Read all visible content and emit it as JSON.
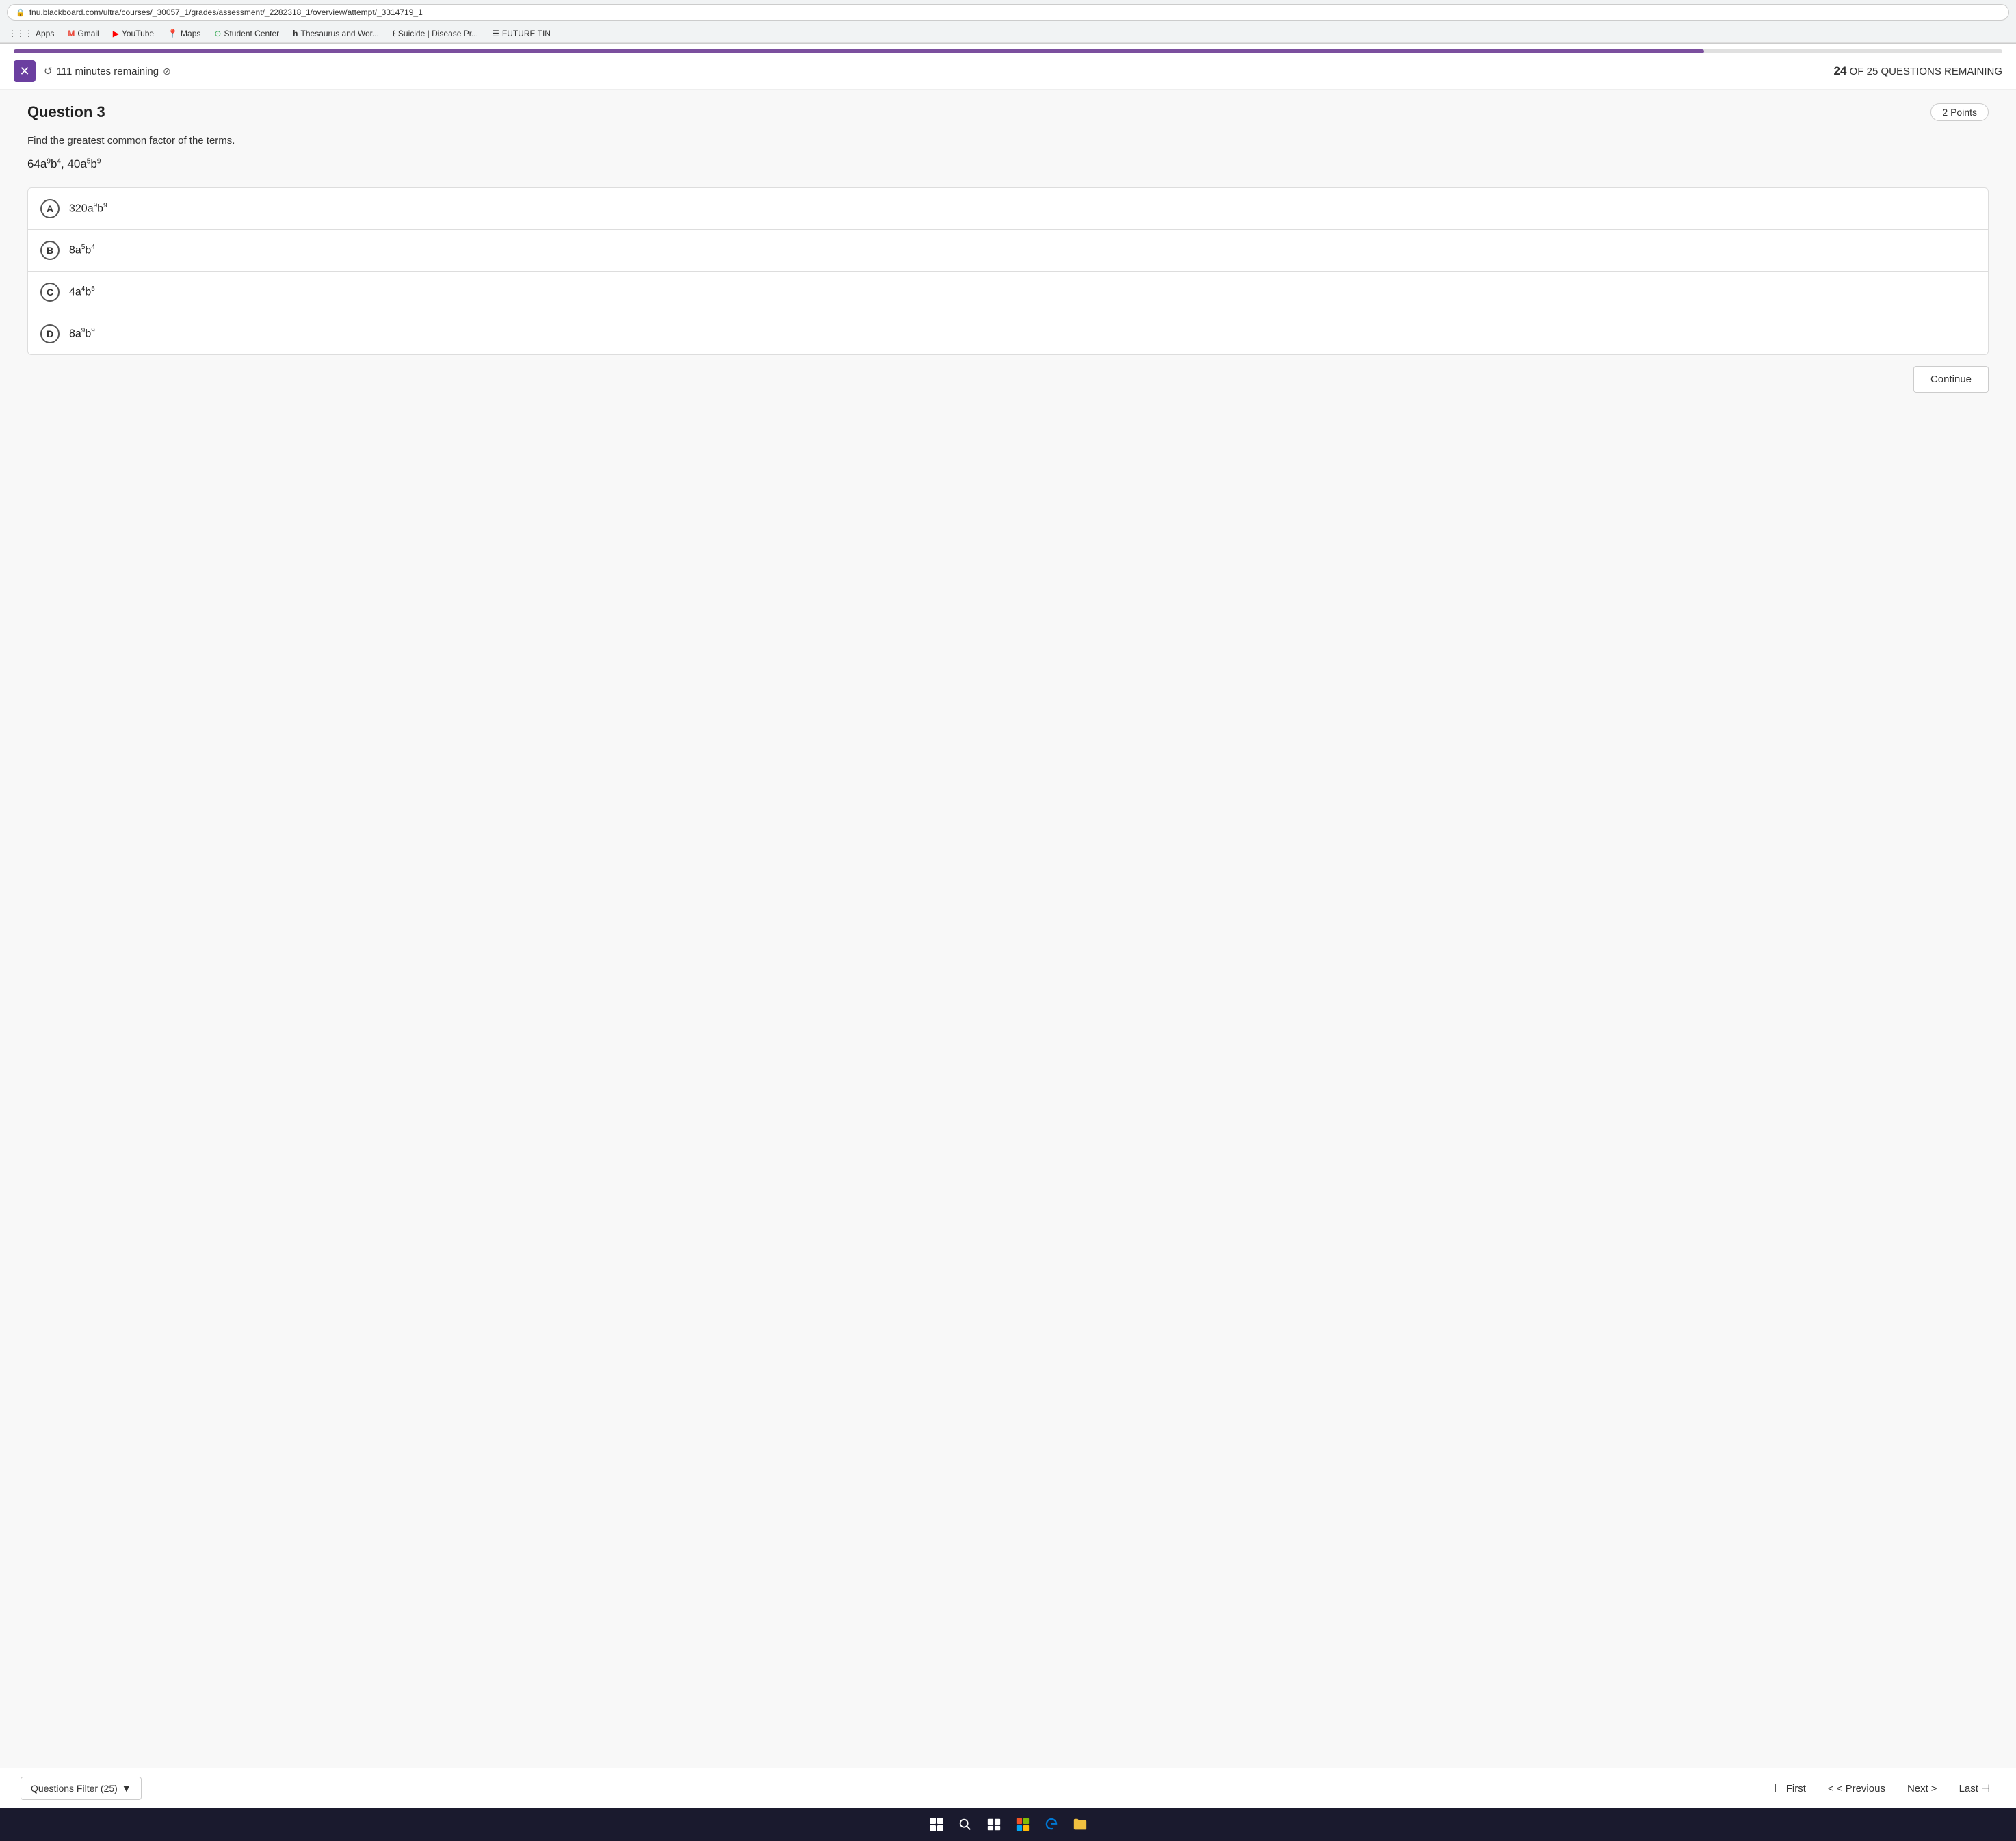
{
  "browser": {
    "url": "fnu.blackboard.com/ultra/courses/_30057_1/grades/assessment/_2282318_1/overview/attempt/_3314719_1",
    "lock_icon": "🔒"
  },
  "bookmarks": [
    {
      "id": "apps",
      "icon": "⋮⋮⋮",
      "label": "Apps"
    },
    {
      "id": "gmail",
      "icon": "M",
      "label": "Gmail"
    },
    {
      "id": "youtube",
      "icon": "▶",
      "label": "YouTube"
    },
    {
      "id": "maps",
      "icon": "📍",
      "label": "Maps"
    },
    {
      "id": "student-center",
      "icon": "⊙",
      "label": "Student Center"
    },
    {
      "id": "thesaurus",
      "icon": "h",
      "label": "Thesaurus and Wor..."
    },
    {
      "id": "suicide",
      "icon": "ℓ",
      "label": "Suicide | Disease Pr..."
    },
    {
      "id": "future-tin",
      "icon": "☰",
      "label": "FUTURE TIN"
    }
  ],
  "quiz": {
    "timer": {
      "text": "111 minutes remaining",
      "icon": "↺",
      "no_calc_icon": "⊘",
      "progress_pct": 85
    },
    "questions_remaining": {
      "current": "24",
      "total": "25",
      "label": "OF 25 QUESTIONS REMAINING"
    },
    "question": {
      "title": "Question 3",
      "points": "2 Points",
      "prompt": "Find the greatest common factor of the terms.",
      "expression": "64a⁹b⁴, 40a⁵b⁹"
    },
    "options": [
      {
        "id": "A",
        "text": "320a⁹b⁹"
      },
      {
        "id": "B",
        "text": "8a⁵b⁴"
      },
      {
        "id": "C",
        "text": "4a⁴b⁵"
      },
      {
        "id": "D",
        "text": "8a⁹b⁹"
      }
    ],
    "continue_btn": "Continue",
    "filter": {
      "label": "Questions Filter (25)",
      "dropdown_icon": "▼"
    },
    "nav": {
      "first": "⊢ First",
      "previous": "< Previous",
      "next": "Next >",
      "last": "Last ⊣"
    }
  }
}
